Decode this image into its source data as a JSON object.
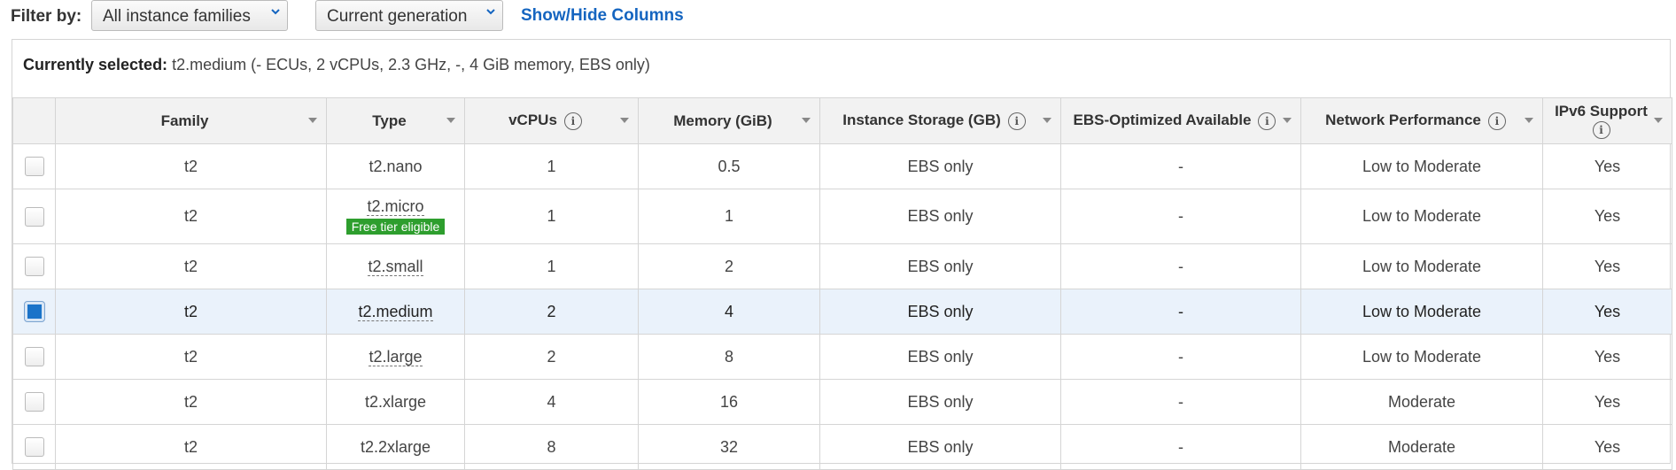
{
  "filter": {
    "label": "Filter by:",
    "family_select": "All instance families",
    "generation_select": "Current generation",
    "columns_link": "Show/Hide Columns"
  },
  "selected": {
    "label": "Currently selected:",
    "value": "t2.medium (- ECUs, 2 vCPUs, 2.3 GHz, -, 4 GiB memory, EBS only)"
  },
  "columns": {
    "family": "Family",
    "type": "Type",
    "vcpus": "vCPUs",
    "memory": "Memory (GiB)",
    "storage": "Instance Storage (GB)",
    "ebs": "EBS-Optimized Available",
    "network": "Network Performance",
    "ipv6": "IPv6 Support"
  },
  "rows": [
    {
      "family": "t2",
      "type": "t2.nano",
      "vcpus": "1",
      "memory": "0.5",
      "storage": "EBS only",
      "ebs": "-",
      "network": "Low to Moderate",
      "ipv6": "Yes",
      "selected": false
    },
    {
      "family": "t2",
      "type": "t2.micro",
      "badge": "Free tier eligible",
      "vcpus": "1",
      "memory": "1",
      "storage": "EBS only",
      "ebs": "-",
      "network": "Low to Moderate",
      "ipv6": "Yes",
      "selected": false
    },
    {
      "family": "t2",
      "type": "t2.small",
      "vcpus": "1",
      "memory": "2",
      "storage": "EBS only",
      "ebs": "-",
      "network": "Low to Moderate",
      "ipv6": "Yes",
      "selected": false
    },
    {
      "family": "t2",
      "type": "t2.medium",
      "vcpus": "2",
      "memory": "4",
      "storage": "EBS only",
      "ebs": "-",
      "network": "Low to Moderate",
      "ipv6": "Yes",
      "selected": true
    },
    {
      "family": "t2",
      "type": "t2.large",
      "vcpus": "2",
      "memory": "8",
      "storage": "EBS only",
      "ebs": "-",
      "network": "Low to Moderate",
      "ipv6": "Yes",
      "selected": false
    },
    {
      "family": "t2",
      "type": "t2.xlarge",
      "vcpus": "4",
      "memory": "16",
      "storage": "EBS only",
      "ebs": "-",
      "network": "Moderate",
      "ipv6": "Yes",
      "selected": false
    },
    {
      "family": "t2",
      "type": "t2.2xlarge",
      "vcpus": "8",
      "memory": "32",
      "storage": "EBS only",
      "ebs": "-",
      "network": "Moderate",
      "ipv6": "Yes",
      "selected": false
    }
  ],
  "icons": {
    "info": "i",
    "chevron": "chevron-down-icon",
    "sort": "sort-caret-icon"
  },
  "colors": {
    "link": "#1565c0",
    "badge": "#2e9e2e",
    "selected_row": "#eaf2fb",
    "checkbox_on": "#1a73c9"
  }
}
